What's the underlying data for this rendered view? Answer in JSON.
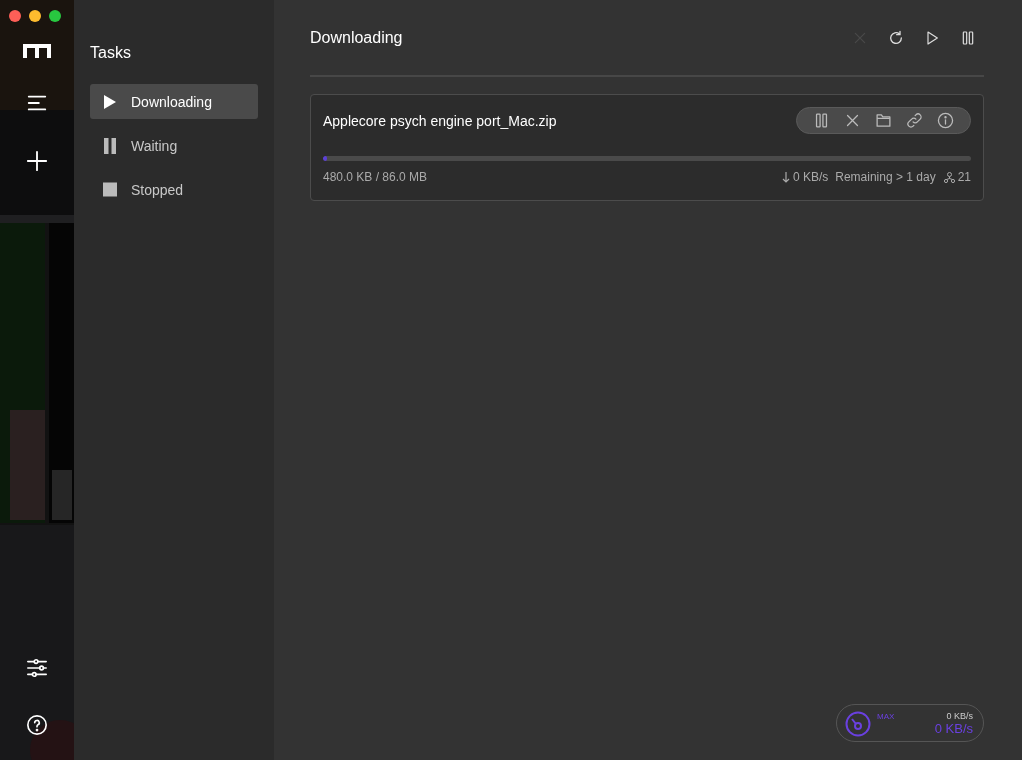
{
  "sidebar": {
    "kind": "picture",
    "actions": [
      {
        "kind": "menu"
      },
      {
        "kind": "add"
      }
    ],
    "footer": [
      {
        "kind": "settings"
      },
      {
        "kind": "help"
      }
    ]
  },
  "tasks_panel": {
    "title": "Tasks",
    "items": [
      {
        "label": "Downloading",
        "kind": "play",
        "selected": true
      },
      {
        "label": "Waiting",
        "kind": "pause",
        "selected": false
      },
      {
        "label": "Stopped",
        "kind": "stop",
        "selected": false
      }
    ]
  },
  "main": {
    "title": "Downloading",
    "toolbar": [
      {
        "kind": "delete",
        "disabled": true
      },
      {
        "kind": "refresh",
        "disabled": false
      },
      {
        "kind": "play",
        "disabled": false
      },
      {
        "kind": "pause",
        "disabled": false
      }
    ],
    "tasks": [
      {
        "name": "Applecore psych engine port_Mac.zip",
        "actions": [
          {
            "kind": "pause"
          },
          {
            "kind": "delete"
          },
          {
            "kind": "folder"
          },
          {
            "kind": "link"
          },
          {
            "kind": "info"
          }
        ],
        "level": 0.0055,
        "size": "480.0 KB / 86.0 MB",
        "speed": "0 KB/s",
        "remaining": "Remaining > 1 day",
        "connections": "21"
      }
    ]
  },
  "speedometer": {
    "limit": "MAX",
    "upload": "0 KB/s",
    "download": "0 KB/s"
  }
}
